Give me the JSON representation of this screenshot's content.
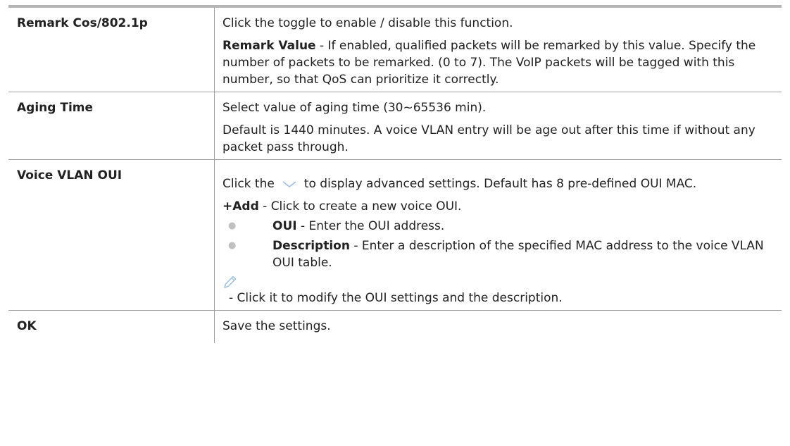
{
  "rows": [
    {
      "term": "Remark Cos/802.1p",
      "line1": "Click the toggle to enable / disable this function.",
      "line2_bold": "Remark Value",
      "line2_rest": " - If enabled, qualified packets will be remarked by this value. Specify the number of packets to be remarked. (0 to 7). The VoIP packets will be tagged with this number, so that QoS can prioritize it correctly."
    },
    {
      "term": "Aging Time",
      "line1": "Select value of aging time (30~65536 min).",
      "line2": "Default is 1440 minutes. A voice VLAN entry will be age out after this time if without any packet pass through."
    },
    {
      "term": "Voice VLAN OUI",
      "line1_pre": "Click the",
      "line1_icon": "chevron-down-icon",
      "line1_post": "to display advanced settings. Default has 8 pre-defined OUI MAC.",
      "add_bold": "+Add",
      "add_rest": " - Click to create a new voice OUI.",
      "bullets": [
        {
          "bold": "OUI",
          "rest": " - Enter the OUI address."
        },
        {
          "bold": "Description",
          "rest": " - Enter a description of the specified MAC address to the voice VLAN OUI table."
        }
      ],
      "edit_icon": "pencil-icon",
      "edit_text": "- Click it to modify the OUI settings and the description."
    },
    {
      "term": "OK",
      "line1": "Save the settings."
    }
  ],
  "colors": {
    "border": "#9f9f9f",
    "top_border": "#b5b5b5",
    "text": "#222222",
    "icon": "#9bbfe0"
  }
}
